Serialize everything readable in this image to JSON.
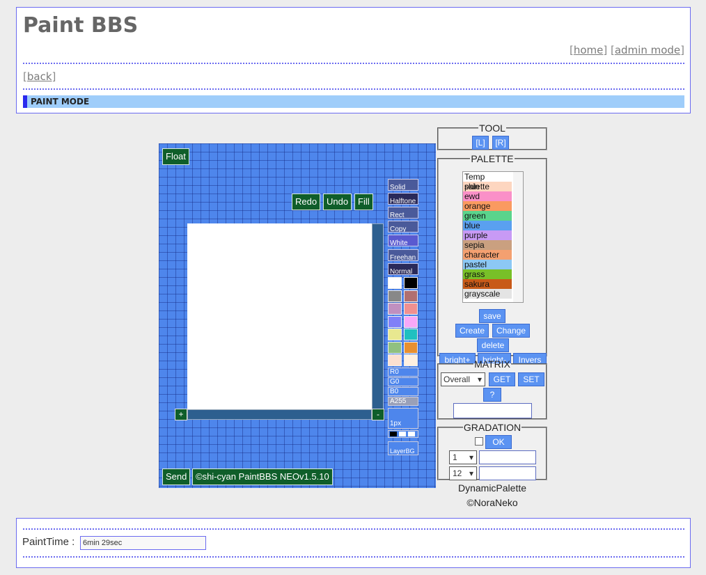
{
  "header": {
    "title": "Paint BBS",
    "links": [
      "home",
      "admin mode"
    ],
    "back": "back",
    "mode": "PAINT MODE"
  },
  "canvas": {
    "float": "Float",
    "redo": "Redo",
    "undo": "Undo",
    "fill": "Fill",
    "send": "Send",
    "copyright": "©shi-cyan PaintBBS NEOv1.5.10",
    "plus": "+",
    "minus": "-",
    "pen_modes": [
      "Solid",
      "Halftone",
      "Rect",
      "Copy",
      "White",
      "Freehan",
      "Normal"
    ],
    "swatches": [
      "#ffffff",
      "#000000",
      "#888888",
      "#b07070",
      "#c090c0",
      "#f09090",
      "#8080f8",
      "#f8a8f8",
      "#e8e890",
      "#20c0c0",
      "#90c080",
      "#e89030",
      "#fce0d0",
      "#fff0e0"
    ],
    "rgba": [
      "R0",
      "G0",
      "B0",
      "A255"
    ],
    "size": "1px",
    "layer": "LayerBG"
  },
  "tool": {
    "legend": "TOOL",
    "left": "[L]",
    "right": "[R]"
  },
  "palette": {
    "legend": "PALETTE",
    "items": [
      {
        "label": "Temp palette",
        "color": "#ffffff"
      },
      {
        "label": "skin",
        "color": "#fdd6c0"
      },
      {
        "label": "ewd",
        "color": "#fa90c8"
      },
      {
        "label": "orange",
        "color": "#fa9a60"
      },
      {
        "label": "green",
        "color": "#5ad48c"
      },
      {
        "label": "blue",
        "color": "#5aa0f0"
      },
      {
        "label": "purple",
        "color": "#c89af5"
      },
      {
        "label": "sepia",
        "color": "#caa080"
      },
      {
        "label": "character",
        "color": "#f4a070"
      },
      {
        "label": "pastel",
        "color": "#8cc8f4"
      },
      {
        "label": "grass",
        "color": "#78c028"
      },
      {
        "label": "sakura",
        "color": "#c85a18"
      },
      {
        "label": "grayscale",
        "color": "#e4e4e4"
      }
    ],
    "save": "save",
    "create": "Create",
    "change": "Change",
    "delete": "delete",
    "bright_plus": "bright+",
    "bright_minus": "bright-",
    "invers": "Invers"
  },
  "matrix": {
    "legend": "MATRIX",
    "select": "Overall",
    "get": "GET",
    "set": "SET",
    "help": "?"
  },
  "gradation": {
    "legend": "GRADATION",
    "ok": "OK",
    "sel1": "1",
    "sel2": "12"
  },
  "credits": [
    "DynamicPalette",
    "©NoraNeko"
  ],
  "footer": {
    "label": "PaintTime :",
    "value": "6min 29sec"
  }
}
